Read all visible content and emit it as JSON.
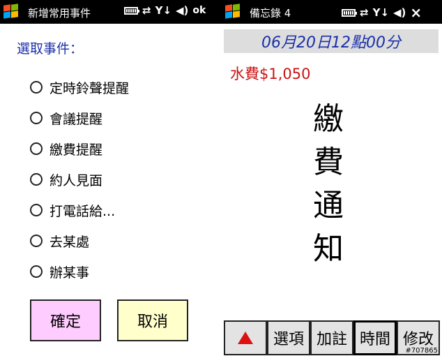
{
  "left": {
    "window_title": "新增常用事件",
    "status_ok": "ok",
    "prompt": "選取事件：",
    "options": [
      "定時鈴聲提醒",
      "會議提醒",
      "繳費提醒",
      "約人見面",
      "打電話給...",
      "去某處",
      "辦某事"
    ],
    "confirm_label": "確定",
    "cancel_label": "取消"
  },
  "right": {
    "window_title": "備忘錄 4",
    "close_glyph": "×",
    "date_header": "06月20日12點00分",
    "memo_line": "水費$1,050",
    "memo_vertical": [
      "繳",
      "費",
      "通",
      "知"
    ],
    "toolbar": [
      "選項",
      "加註",
      "時間",
      "修改"
    ],
    "selected_tool": "時間"
  },
  "watermark": "#707865",
  "colors": {
    "accent_blue": "#1a2fa8",
    "alert_red": "#cc1111",
    "confirm_bg": "#ffccff",
    "cancel_bg": "#ffffcc"
  }
}
